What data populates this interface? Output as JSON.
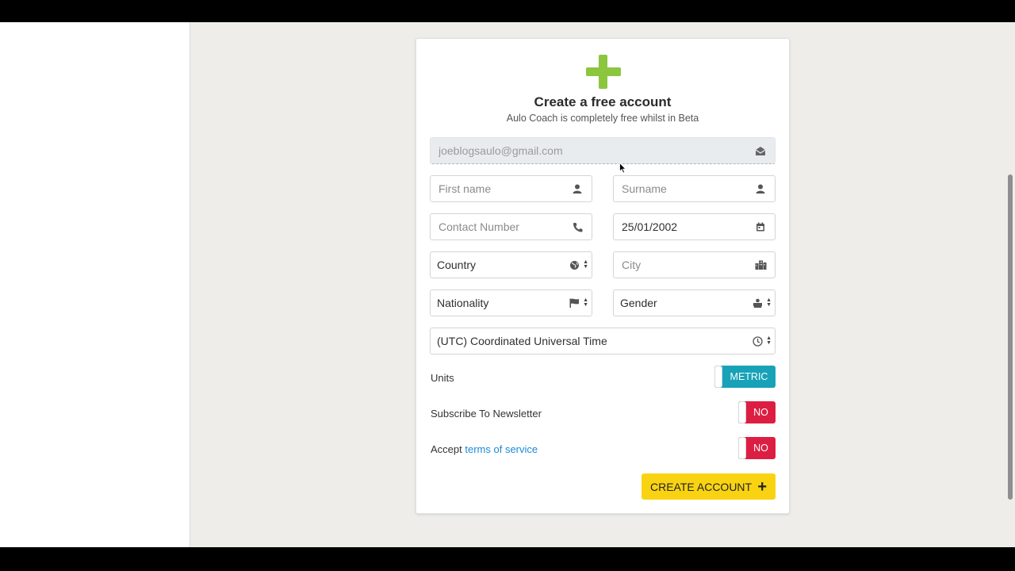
{
  "header": {
    "title": "Create a free account",
    "subtitle": "Aulo Coach is completely free whilst in Beta"
  },
  "form": {
    "email": {
      "value": "joeblogsaulo@gmail.com",
      "icon": "envelope-open-icon"
    },
    "first_name": {
      "placeholder": "First name",
      "icon": "user-icon"
    },
    "surname": {
      "placeholder": "Surname",
      "icon": "user-icon"
    },
    "contact_number": {
      "placeholder": "Contact Number",
      "icon": "phone-icon"
    },
    "date_of_birth": {
      "value": "25/01/2002",
      "icon": "calendar-icon"
    },
    "country": {
      "value": "Country",
      "icon": "globe-icon"
    },
    "city": {
      "placeholder": "City",
      "icon": "city-icon"
    },
    "nationality": {
      "value": "Nationality",
      "icon": "flag-icon"
    },
    "gender": {
      "value": "Gender",
      "icon": "gender-icon"
    },
    "timezone": {
      "value": "(UTC) Coordinated Universal Time",
      "icon": "clock-icon"
    },
    "units": {
      "label": "Units",
      "toggle": "METRIC"
    },
    "newsletter": {
      "label": "Subscribe To Newsletter",
      "toggle": "NO"
    },
    "terms": {
      "label": "Accept",
      "link": "terms of service",
      "toggle": "NO"
    },
    "submit": {
      "label": "CREATE ACCOUNT"
    }
  },
  "colors": {
    "brand_green": "#8cc63f",
    "toggle_teal": "#17a2b8",
    "toggle_red": "#dc1e42",
    "button_yellow": "#f9d312",
    "link_blue": "#1b8ad6"
  }
}
